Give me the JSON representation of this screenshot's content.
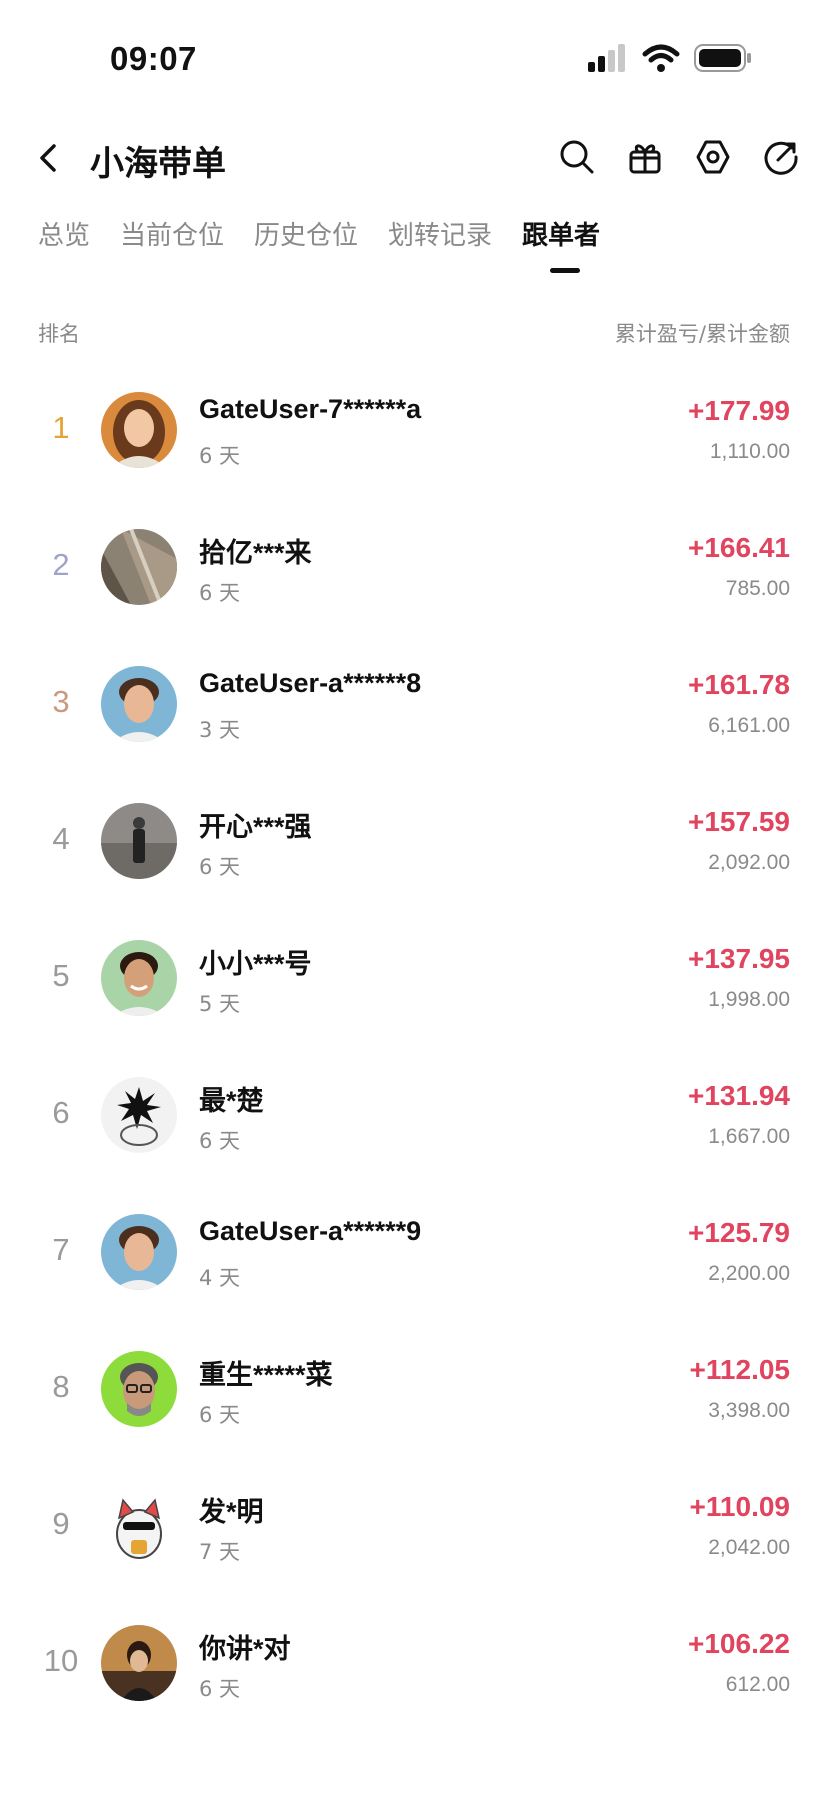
{
  "status_bar": {
    "time": "09:07",
    "icons": [
      "signal-icon",
      "wifi-icon",
      "battery-icon"
    ]
  },
  "header": {
    "title": "小海带单",
    "icons": [
      "back-icon",
      "search-icon",
      "gift-icon",
      "settings-icon",
      "share-icon"
    ]
  },
  "tabs": [
    {
      "label": "总览",
      "active": false
    },
    {
      "label": "当前仓位",
      "active": false
    },
    {
      "label": "历史仓位",
      "active": false
    },
    {
      "label": "划转记录",
      "active": false
    },
    {
      "label": "跟单者",
      "active": true
    }
  ],
  "columns": {
    "left": "排名",
    "right": "累计盈亏/累计金额"
  },
  "colors": {
    "profit": "#e0445e",
    "rank_1": "#e4a534",
    "rank_2": "#9fa3c9",
    "rank_3": "#c99a7f",
    "rank_default": "#9a9a9a",
    "muted": "#8a8a8a"
  },
  "followers": [
    {
      "rank": "1",
      "name": "GateUser-7******a",
      "days": "6 天",
      "pnl": "+177.99",
      "amount": "1,110.00"
    },
    {
      "rank": "2",
      "name": "拾亿***来",
      "days": "6 天",
      "pnl": "+166.41",
      "amount": "785.00"
    },
    {
      "rank": "3",
      "name": "GateUser-a******8",
      "days": "3 天",
      "pnl": "+161.78",
      "amount": "6,161.00"
    },
    {
      "rank": "4",
      "name": "开心***强",
      "days": "6 天",
      "pnl": "+157.59",
      "amount": "2,092.00"
    },
    {
      "rank": "5",
      "name": "小小***号",
      "days": "5 天",
      "pnl": "+137.95",
      "amount": "1,998.00"
    },
    {
      "rank": "6",
      "name": "最*楚",
      "days": "6 天",
      "pnl": "+131.94",
      "amount": "1,667.00"
    },
    {
      "rank": "7",
      "name": "GateUser-a******9",
      "days": "4 天",
      "pnl": "+125.79",
      "amount": "2,200.00"
    },
    {
      "rank": "8",
      "name": "重生*****菜",
      "days": "6 天",
      "pnl": "+112.05",
      "amount": "3,398.00"
    },
    {
      "rank": "9",
      "name": "发*明",
      "days": "7 天",
      "pnl": "+110.09",
      "amount": "2,042.00"
    },
    {
      "rank": "10",
      "name": "你讲*对",
      "days": "6 天",
      "pnl": "+106.22",
      "amount": "612.00"
    }
  ]
}
